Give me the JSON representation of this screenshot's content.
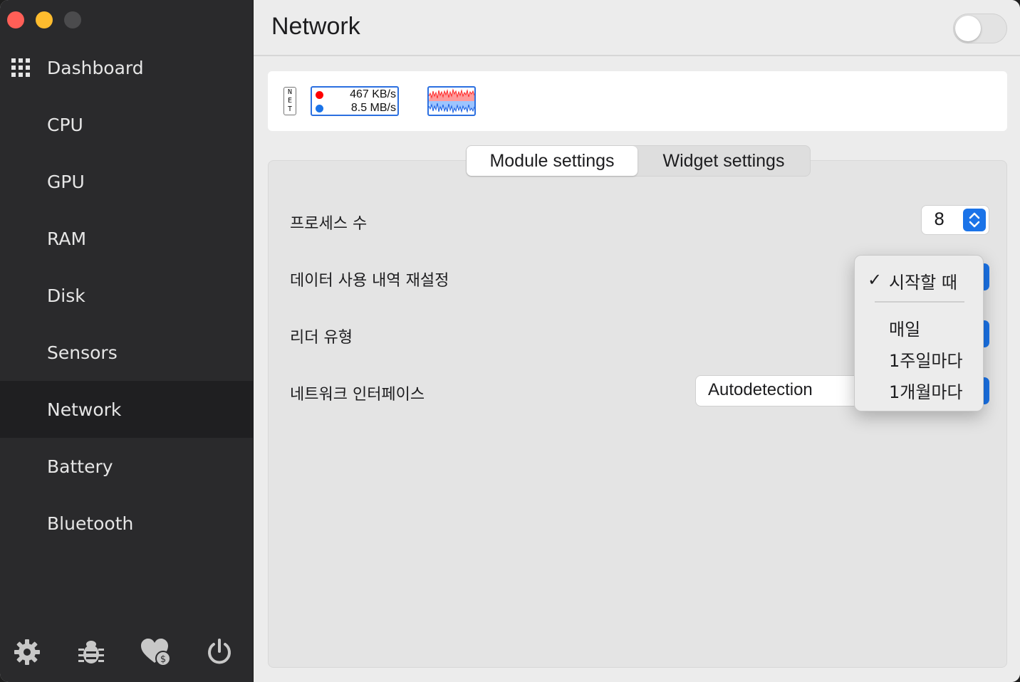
{
  "window": {
    "traffic_lights": [
      "close",
      "minimize",
      "zoom"
    ]
  },
  "sidebar": {
    "items": [
      {
        "label": "Dashboard",
        "icon": "grid-icon"
      },
      {
        "label": "CPU"
      },
      {
        "label": "GPU"
      },
      {
        "label": "RAM"
      },
      {
        "label": "Disk"
      },
      {
        "label": "Sensors"
      },
      {
        "label": "Network",
        "active": true
      },
      {
        "label": "Battery"
      },
      {
        "label": "Bluetooth"
      }
    ],
    "bottom_icons": [
      "gear-icon",
      "bug-icon",
      "heart-donate-icon",
      "power-icon"
    ]
  },
  "header": {
    "title": "Network",
    "module_enabled": false
  },
  "preview": {
    "net_label": [
      "N",
      "E",
      "T"
    ],
    "upload_speed": "467 KB/s",
    "download_speed": "8.5 MB/s",
    "upload_color": "#ff0000",
    "download_color": "#1a73e8"
  },
  "tabs": {
    "module_settings": "Module settings",
    "widget_settings": "Widget settings",
    "active": "module_settings"
  },
  "settings": {
    "process_count_label": "프로세스 수",
    "process_count_value": "8",
    "reset_usage_label": "데이터 사용 내역 재설정",
    "reader_type_label": "리더 유형",
    "interface_label": "네트워크 인터페이스",
    "interface_value": "Autodetection"
  },
  "popup_menu": {
    "checked": "시작할 때",
    "options": [
      "매일",
      "1주일마다",
      "1개월마다"
    ]
  },
  "colors": {
    "sidebar_bg": "#2a2a2c",
    "accent": "#1a73e8"
  }
}
